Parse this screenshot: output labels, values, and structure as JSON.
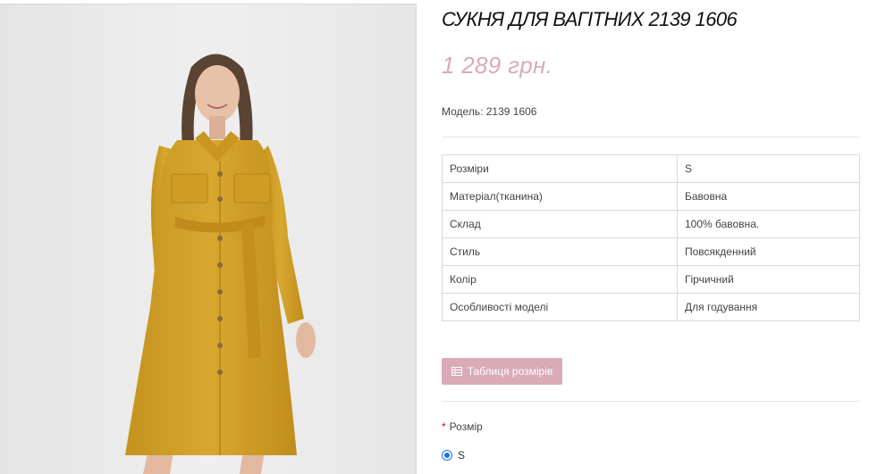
{
  "product": {
    "title": "СУКНЯ ДЛЯ ВАГІТНИХ 2139 1606",
    "price": "1 289 грн.",
    "model_label": "Модель:",
    "model_value": "2139 1606"
  },
  "specs": [
    {
      "key": "Розміри",
      "value": "S"
    },
    {
      "key": "Матеріал(тканина)",
      "value": "Бавовна"
    },
    {
      "key": "Склад",
      "value": "100% бавовна."
    },
    {
      "key": "Стиль",
      "value": "Повсякденний"
    },
    {
      "key": "Колір",
      "value": "Гірчичний"
    },
    {
      "key": "Особливості моделі",
      "value": "Для годування"
    }
  ],
  "size_chart_button": {
    "label": "Таблиця розмірів",
    "icon": "table-icon"
  },
  "size_option": {
    "required_mark": "*",
    "label": "Розмір",
    "options": [
      {
        "label": "S",
        "selected": true
      }
    ]
  },
  "colors": {
    "accent": "#d9aab8",
    "dress": "#d4a32a",
    "radio": "#1a73e8"
  }
}
